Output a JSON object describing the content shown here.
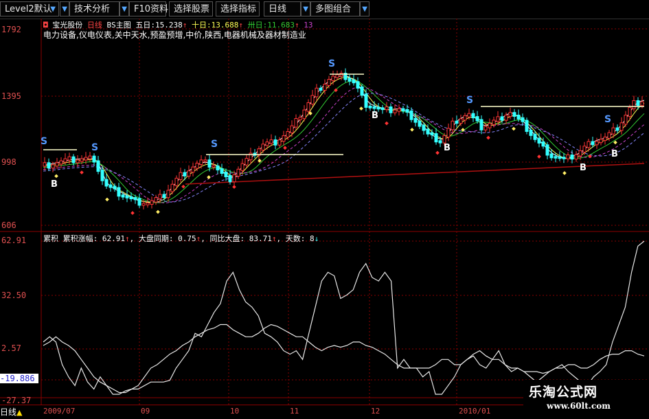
{
  "toolbar": {
    "buttons": [
      {
        "label": "Level2默认",
        "arrow": "▼"
      },
      {
        "label": "技术分析",
        "arrow": "▼"
      },
      {
        "label": "F10资料",
        "arrow": "▼"
      },
      {
        "label": "选择股票",
        "arrow": ""
      },
      {
        "label": "选择指标",
        "arrow": ""
      },
      {
        "label": "日线",
        "arrow": "▼"
      },
      {
        "label": "多图组合",
        "arrow": "▼"
      }
    ]
  },
  "main_chart": {
    "stock_name": "宝光股份",
    "period": "日线",
    "indicator": "BS主图",
    "ma5_label": "五日:",
    "ma5_value": "15.238",
    "ma10_label": "十日:",
    "ma10_value": "13.688",
    "ma30_label": "卅日:",
    "ma30_value": "11.683",
    "extra_value": "13",
    "up_arrow": "↑",
    "sectors": "电力设备,仪电仪表,关中天水,预盈预增,中价,陕西,电器机械及器材制造业",
    "y_labels": [
      "1792",
      "1395",
      "998",
      "606"
    ],
    "markers": {
      "sell": "S",
      "buy": "B"
    }
  },
  "sub_chart": {
    "name": "累积",
    "item1_label": "累积涨幅:",
    "item1_value": "62.91",
    "item2_label": "大盘同期:",
    "item2_value": "0.75",
    "item3_label": "同比大盘:",
    "item3_value": "83.71",
    "item4_label": "天数:",
    "item4_value": "8",
    "up_arrow": "↑",
    "down_arrow": "↓",
    "y_labels": [
      "62.91",
      "32.50",
      "2.57",
      "-19.886",
      "-27.37"
    ],
    "series_stock": [
      5,
      8,
      5,
      -8,
      -15,
      -20,
      -10,
      -18,
      -22,
      -15,
      -20,
      -25,
      -25,
      -23,
      -22,
      -22,
      -20,
      -18,
      -18,
      -18,
      -17,
      -10,
      -5,
      0,
      10,
      8,
      15,
      22,
      27,
      40,
      45,
      35,
      28,
      25,
      20,
      10,
      8,
      5,
      0,
      -2,
      0,
      -5,
      10,
      25,
      40,
      45,
      43,
      30,
      32,
      35,
      45,
      50,
      42,
      40,
      45,
      40,
      -10,
      -5,
      -10,
      -10,
      -15,
      -12,
      -25,
      -25,
      -20,
      -15,
      -8,
      -5,
      -3,
      -8,
      -10,
      -5,
      0,
      -8,
      -12,
      -10,
      -12,
      -15,
      -18,
      -15,
      -12,
      -10,
      -8,
      -12,
      -15,
      -18,
      -20,
      -15,
      -12,
      -8,
      5,
      15,
      25,
      45,
      60,
      62.91
    ],
    "series_index": [
      3,
      5,
      8,
      5,
      3,
      0,
      -5,
      -10,
      -15,
      -18,
      -20,
      -22,
      -24,
      -24,
      -22,
      -20,
      -15,
      -10,
      -8,
      -5,
      -2,
      0,
      3,
      5,
      8,
      10,
      12,
      13,
      15,
      15,
      12,
      10,
      8,
      8,
      10,
      13,
      15,
      14,
      12,
      10,
      8,
      8,
      5,
      2,
      0,
      2,
      3,
      2,
      3,
      5,
      5,
      3,
      2,
      0,
      -2,
      -5,
      -8,
      -10,
      -10,
      -10,
      -10,
      -10,
      -8,
      -5,
      -5,
      -8,
      -8,
      -5,
      -2,
      0,
      -3,
      -5,
      -5,
      -8,
      -10,
      -10,
      -12,
      -12,
      -12,
      -13,
      -12,
      -10,
      -10,
      -8,
      -8,
      -10,
      -10,
      -8,
      -5,
      -3,
      -2,
      -2,
      0,
      0,
      -2,
      -3
    ]
  },
  "dates": [
    "2009/07",
    "09",
    "10",
    "11",
    "12",
    "2010/01"
  ],
  "bottom_tab": "日线",
  "bottom_tab_icon": "triangle-icon",
  "watermark": {
    "title": "乐淘公式网",
    "url": "www.60lt.com"
  },
  "colors": {
    "up": "#ff3333",
    "down": "#33ffff",
    "grid": "#8b0000",
    "ma5": "#ffffff",
    "ma10": "#ffff55",
    "ma30": "#33cc33",
    "ma60": "#cc44cc",
    "axis_text": "#e05050"
  }
}
